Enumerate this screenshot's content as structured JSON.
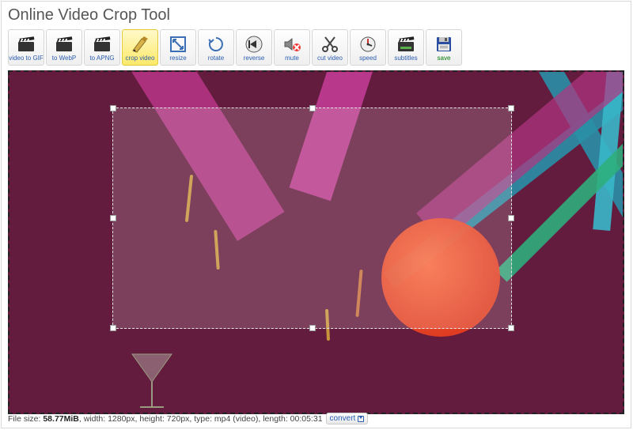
{
  "title": "Online Video Crop Tool",
  "toolbar": [
    {
      "id": "gif",
      "label": "video to GIF",
      "icon": "clapper"
    },
    {
      "id": "webp",
      "label": "to WebP",
      "icon": "clapper"
    },
    {
      "id": "apng",
      "label": "to APNG",
      "icon": "clapper"
    },
    {
      "id": "crop",
      "label": "crop video",
      "icon": "crop-pen",
      "active": true
    },
    {
      "id": "resize",
      "label": "resize",
      "icon": "resize"
    },
    {
      "id": "rotate",
      "label": "rotate",
      "icon": "rotate"
    },
    {
      "id": "reverse",
      "label": "reverse",
      "icon": "reverse"
    },
    {
      "id": "mute",
      "label": "mute",
      "icon": "mute"
    },
    {
      "id": "cut",
      "label": "cut video",
      "icon": "scissors"
    },
    {
      "id": "speed",
      "label": "speed",
      "icon": "speed"
    },
    {
      "id": "subtitles",
      "label": "subtitles",
      "icon": "clapper"
    },
    {
      "id": "save",
      "label": "save",
      "icon": "floppy"
    }
  ],
  "fileinfo": {
    "size_label": "File size: ",
    "size_value": "58.77MiB",
    "width_label": ", width: ",
    "width_value": "1280px",
    "height_label": ", height: ",
    "height_value": "720px",
    "type_label": ", type: ",
    "type_value": "mp4 (video)",
    "length_label": ", length: ",
    "length_value": "00:05:31"
  },
  "convert_label": "convert"
}
